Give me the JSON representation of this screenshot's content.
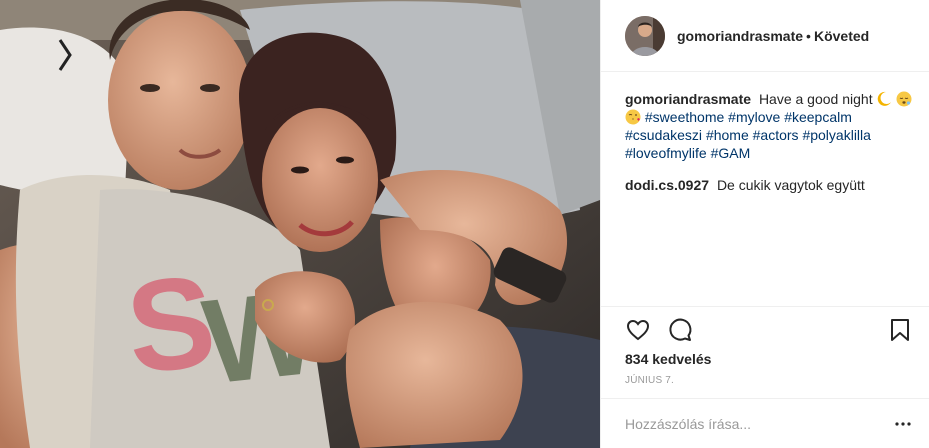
{
  "post": {
    "username": "gomoriandrasmate",
    "separator": "•",
    "follow_status": "Követed",
    "caption": {
      "username": "gomoriandrasmate",
      "text": "Have a good night",
      "hashtags": [
        "#sweethome",
        "#mylove",
        "#keepcalm",
        "#csudakeszi",
        "#home",
        "#actors",
        "#polyaklilla",
        "#loveofmylife",
        "#GAM"
      ],
      "emojis": [
        "crescent-moon",
        "sleeping-face",
        "blowing-kiss"
      ]
    },
    "comments": [
      {
        "username": "dodi.cs.0927",
        "text": "De cukik vagytok együtt"
      }
    ],
    "likes": "834 kedvelés",
    "date": "JÚNIUS 7.",
    "comment_input": {
      "placeholder": "Hozzászólás írása..."
    },
    "icons": [
      "heart-icon",
      "comment-icon",
      "bookmark-icon",
      "more-options-icon"
    ],
    "colors": {
      "hashtag": "#003569",
      "text": "#262626",
      "muted": "#999999",
      "divider": "#efefef"
    }
  }
}
